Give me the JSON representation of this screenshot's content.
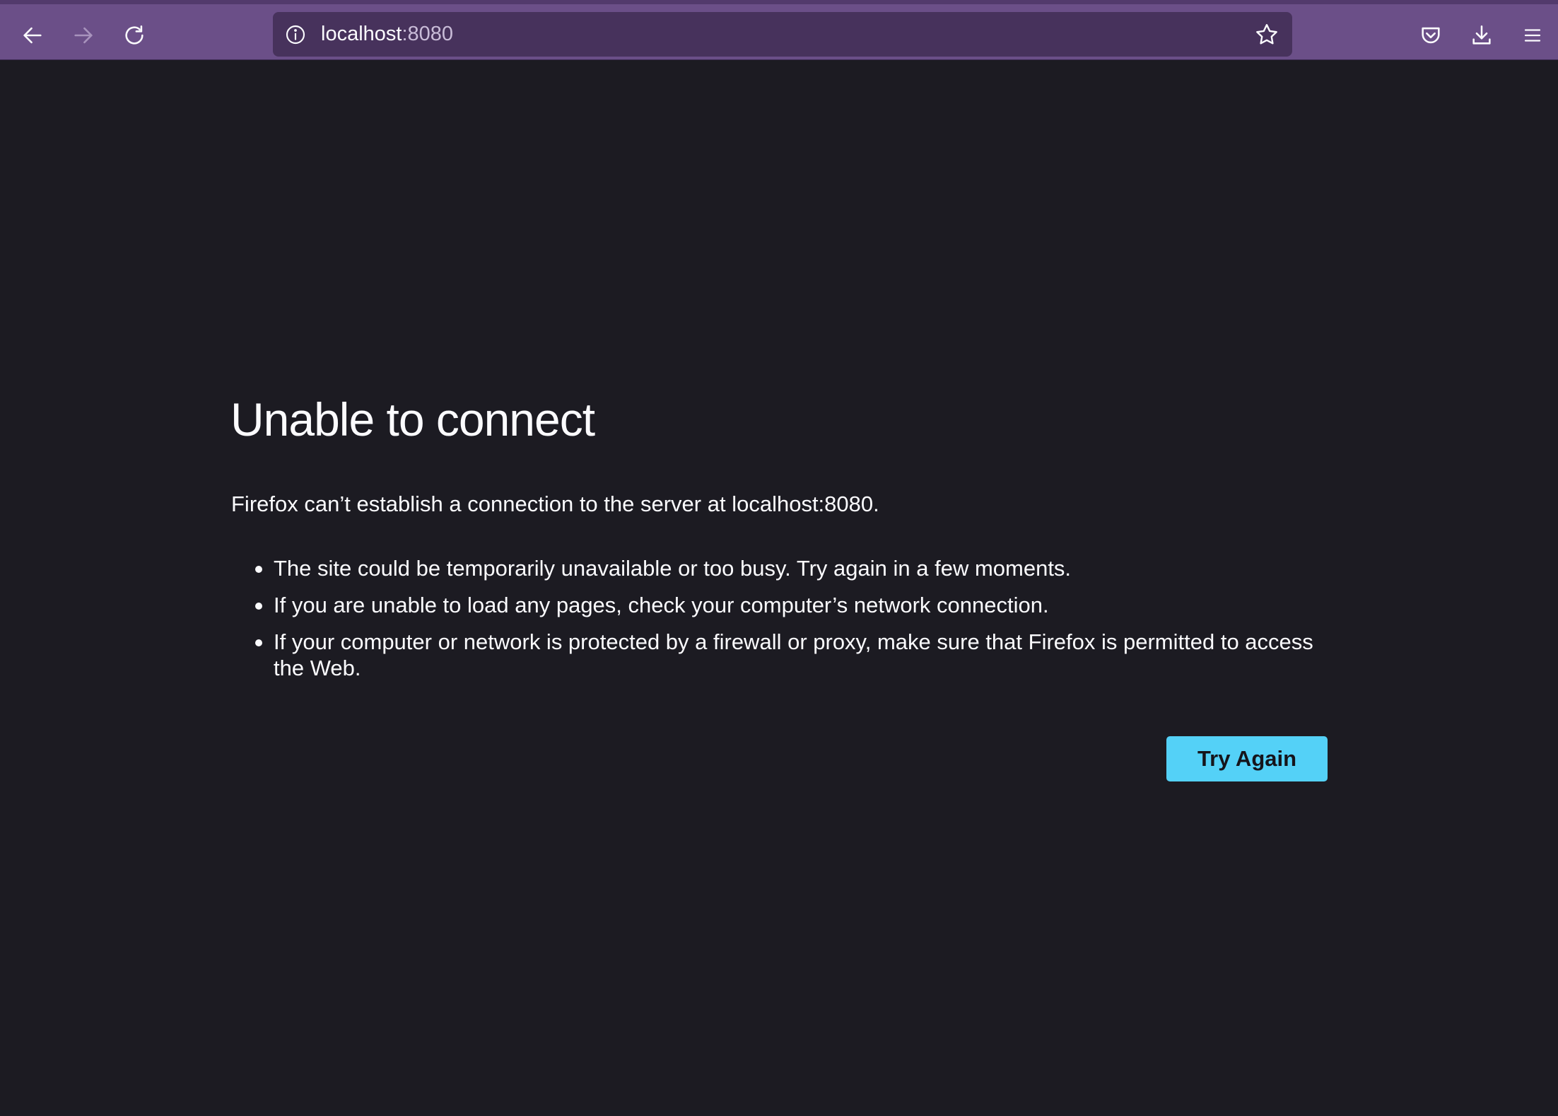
{
  "toolbar": {
    "back_icon": "arrow-left-icon",
    "forward_icon": "arrow-right-icon",
    "reload_icon": "reload-icon",
    "pocket_icon": "pocket-icon",
    "download_icon": "download-icon",
    "menu_icon": "hamburger-menu-icon",
    "background_color": "#6b4f88"
  },
  "urlbar": {
    "info_icon": "info-icon",
    "host": "localhost",
    "port": ":8080",
    "bookmark_icon": "star-icon",
    "background_color": "#47325c"
  },
  "error": {
    "title": "Unable to connect",
    "description": "Firefox can’t establish a connection to the server at localhost:8080.",
    "bullets": [
      "The site could be temporarily unavailable or too busy. Try again in a few moments.",
      "If you are unable to load any pages, check your computer’s network connection.",
      "If your computer or network is protected by a firewall or proxy, make sure that Firefox is permitted to access the Web."
    ],
    "try_again_label": "Try Again",
    "button_color": "#54d1f7",
    "page_background": "#1c1b22"
  }
}
